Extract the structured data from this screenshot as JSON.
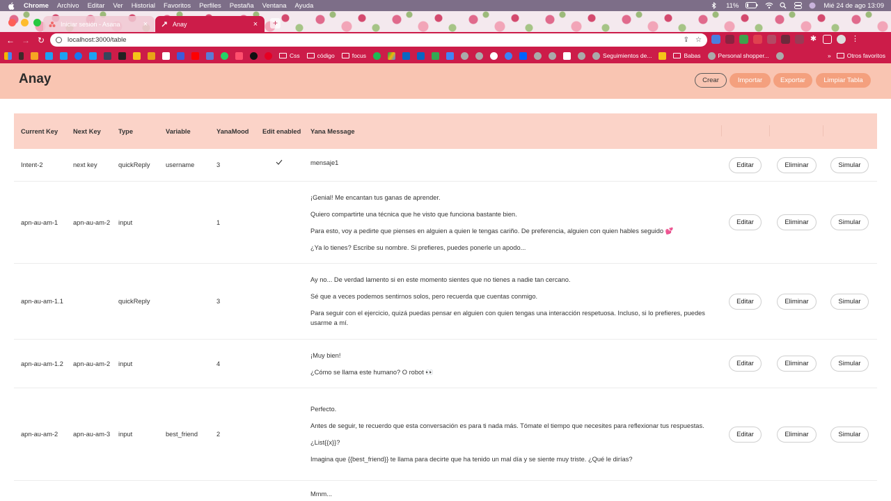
{
  "menubar": {
    "app": "Chrome",
    "items": [
      "Archivo",
      "Editar",
      "Ver",
      "Historial",
      "Favoritos",
      "Perfiles",
      "Pestaña",
      "Ventana",
      "Ayuda"
    ],
    "battery": "11%",
    "datetime": "Mié 24 de ago  13:09"
  },
  "browser": {
    "tabs": [
      {
        "title": "Iniciar sesión - Asana",
        "active": false
      },
      {
        "title": "Anay",
        "active": true
      }
    ],
    "url": "localhost:3000/table",
    "bookmarks": {
      "folders": [
        "Css",
        "código",
        "focus"
      ],
      "links": [
        "Seguimientos de...",
        "Babas",
        "Personal shopper..."
      ],
      "more": "»",
      "other_folder": "Otros favoritos"
    }
  },
  "app": {
    "title": "Anay",
    "buttons": {
      "create": "Crear",
      "import": "Importar",
      "export": "Exportar",
      "clear": "Limpiar Tabla"
    }
  },
  "table": {
    "columns": [
      "Current Key",
      "Next Key",
      "Type",
      "Variable",
      "YanaMood",
      "Edit enabled",
      "Yana Message"
    ],
    "actions": {
      "edit": "Editar",
      "delete": "Eliminar",
      "simulate": "Simular"
    },
    "rows": [
      {
        "current_key": "Intent-2",
        "next_key": "next key",
        "type": "quickReply",
        "variable": "username",
        "mood": "3",
        "edit_enabled": true,
        "message": [
          "mensaje1"
        ]
      },
      {
        "current_key": "apn-au-am-1",
        "next_key": "apn-au-am-2",
        "type": "input",
        "variable": "",
        "mood": "1",
        "edit_enabled": false,
        "message": [
          "¡Genial! Me encantan tus ganas de aprender.",
          "Quiero compartirte una técnica que he visto que funciona bastante bien.",
          "Para esto, voy a pedirte que pienses en alguien a quien le tengas cariño. De preferencia, alguien con quien hables seguido 💕",
          "¿Ya lo tienes? Escribe su nombre. Si prefieres, puedes ponerle un apodo..."
        ]
      },
      {
        "current_key": "apn-au-am-1.1",
        "next_key": "",
        "type": "quickReply",
        "variable": "",
        "mood": "3",
        "edit_enabled": false,
        "message": [
          "Ay no... De verdad lamento si en este momento sientes que no tienes a nadie tan cercano.",
          "Sé que a veces podemos sentirnos solos, pero recuerda que cuentas conmigo.",
          "Para seguir con el ejercicio, quizá puedas pensar en alguien con quien tengas una interacción respetuosa. Incluso, si lo prefieres, puedes usarme a mí."
        ]
      },
      {
        "current_key": "apn-au-am-1.2",
        "next_key": "apn-au-am-2",
        "type": "input",
        "variable": "",
        "mood": "4",
        "edit_enabled": false,
        "message": [
          "¡Muy bien!",
          "¿Cómo se llama este humano? O robot 👀"
        ]
      },
      {
        "current_key": "apn-au-am-2",
        "next_key": "apn-au-am-3",
        "type": "input",
        "variable": "best_friend",
        "mood": "2",
        "edit_enabled": false,
        "message": [
          "Perfecto.",
          "Antes de seguir, te recuerdo que esta conversación es para ti nada más. Tómate el tiempo que necesites para reflexionar tus respuestas.",
          "¿List{{x}}?",
          "Imagina que {{best_friend}} te llama para decirte que ha tenido un mal día y se siente muy triste. ¿Qué le dirías?"
        ]
      },
      {
        "current_key": "",
        "next_key": "",
        "type": "",
        "variable": "",
        "mood": "",
        "edit_enabled": false,
        "message": [
          "Mmm..."
        ]
      }
    ]
  }
}
